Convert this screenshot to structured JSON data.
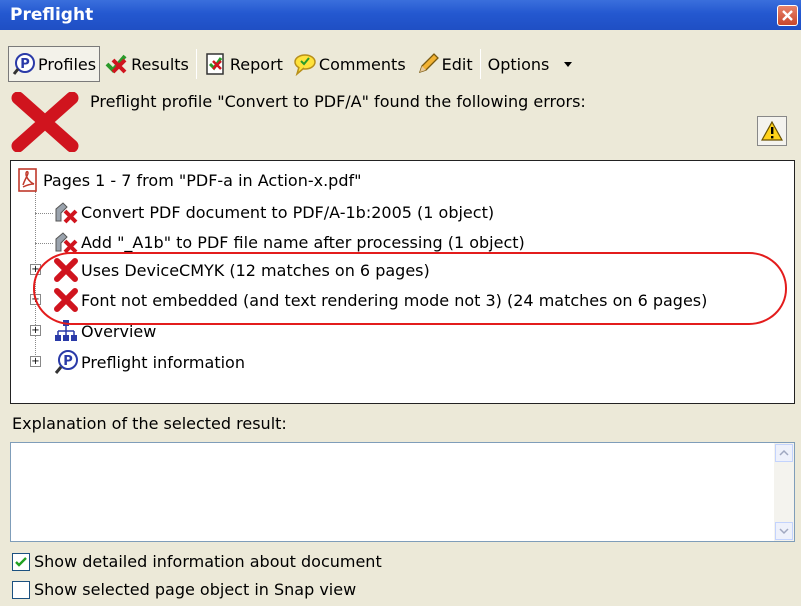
{
  "window": {
    "title": "Preflight"
  },
  "toolbar": {
    "profiles_label": "Profiles",
    "results_label": "Results",
    "report_label": "Report",
    "comments_label": "Comments",
    "edit_label": "Edit",
    "options_label": "Options"
  },
  "header": {
    "message": "Preflight profile \"Convert to PDF/A\" found the following errors:"
  },
  "tree": {
    "root": "Pages 1 - 7 from \"PDF-a in Action-x.pdf\"",
    "items": [
      {
        "label": "Convert PDF document to PDF/A-1b:2005 (1 object)",
        "icon": "fix-x-icon"
      },
      {
        "label": "Add \"_A1b\" to PDF file name after processing (1 object)",
        "icon": "fix-x-icon"
      },
      {
        "label": "Uses DeviceCMYK (12 matches on 6 pages)",
        "icon": "red-x-icon"
      },
      {
        "label": "Font not embedded (and text rendering mode not 3) (24 matches on 6 pages)",
        "icon": "red-x-icon"
      },
      {
        "label": "Overview",
        "icon": "overview-icon"
      },
      {
        "label": "Preflight information",
        "icon": "preflight-info-icon"
      }
    ]
  },
  "explanation": {
    "label": "Explanation of the selected result:",
    "value": ""
  },
  "options": {
    "show_detailed": {
      "label": "Show detailed information about document",
      "checked": true
    },
    "show_snap": {
      "label": "Show selected page object in Snap view",
      "checked": false
    }
  },
  "colors": {
    "titlebar": "#2458d0",
    "error_red": "#d0141e",
    "annotation": "#e31c1c"
  }
}
